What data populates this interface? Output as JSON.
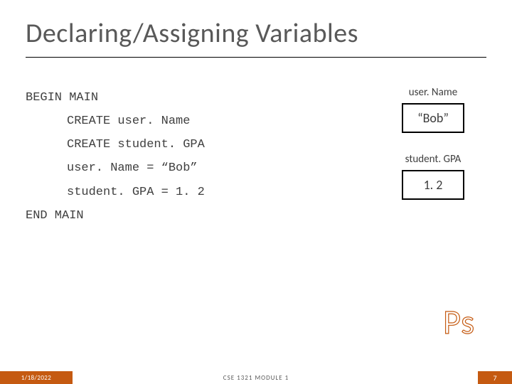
{
  "title": "Declaring/Assigning Variables",
  "code": {
    "line1": "BEGIN MAIN",
    "line2": "CREATE user. Name",
    "line3": "CREATE student. GPA",
    "line4": "user. Name = “Bob”",
    "line5": "student. GPA = 1. 2",
    "line6": "END MAIN"
  },
  "vars": {
    "label1": "user. Name",
    "value1": "“Bob”",
    "label2": "student. GPA",
    "value2": "1. 2"
  },
  "ps_label": "Ps",
  "footer": {
    "date": "1/18/2022",
    "center": "CSE 1321 MODULE 1",
    "page": "7"
  }
}
